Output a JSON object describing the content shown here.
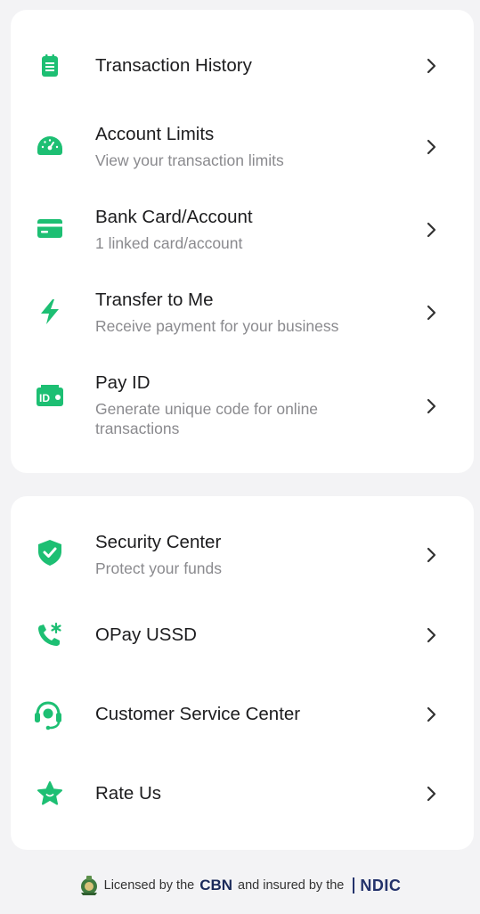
{
  "colors": {
    "accent": "#1dbf73",
    "background": "#f3f3f5",
    "card": "#ffffff"
  },
  "menu_group_1": [
    {
      "icon": "clipboard-list-icon",
      "title": "Transaction History",
      "subtitle": ""
    },
    {
      "icon": "speedometer-icon",
      "title": "Account Limits",
      "subtitle": "View your transaction limits"
    },
    {
      "icon": "bank-card-icon",
      "title": "Bank Card/Account",
      "subtitle": "1 linked card/account"
    },
    {
      "icon": "lightning-bolt-icon",
      "title": "Transfer to Me",
      "subtitle": "Receive payment for your business"
    },
    {
      "icon": "id-card-icon",
      "title": "Pay ID",
      "subtitle": "Generate unique code for online transactions"
    }
  ],
  "menu_group_2": [
    {
      "icon": "shield-check-icon",
      "title": "Security Center",
      "subtitle": "Protect your funds"
    },
    {
      "icon": "phone-asterisk-icon",
      "title": "OPay USSD",
      "subtitle": ""
    },
    {
      "icon": "headset-icon",
      "title": "Customer Service Center",
      "subtitle": ""
    },
    {
      "icon": "star-icon",
      "title": "Rate Us",
      "subtitle": ""
    }
  ],
  "footer": {
    "prefix": "Licensed by the",
    "cbn": "CBN",
    "middle": "and insured by the",
    "ndic": "NDIC"
  }
}
